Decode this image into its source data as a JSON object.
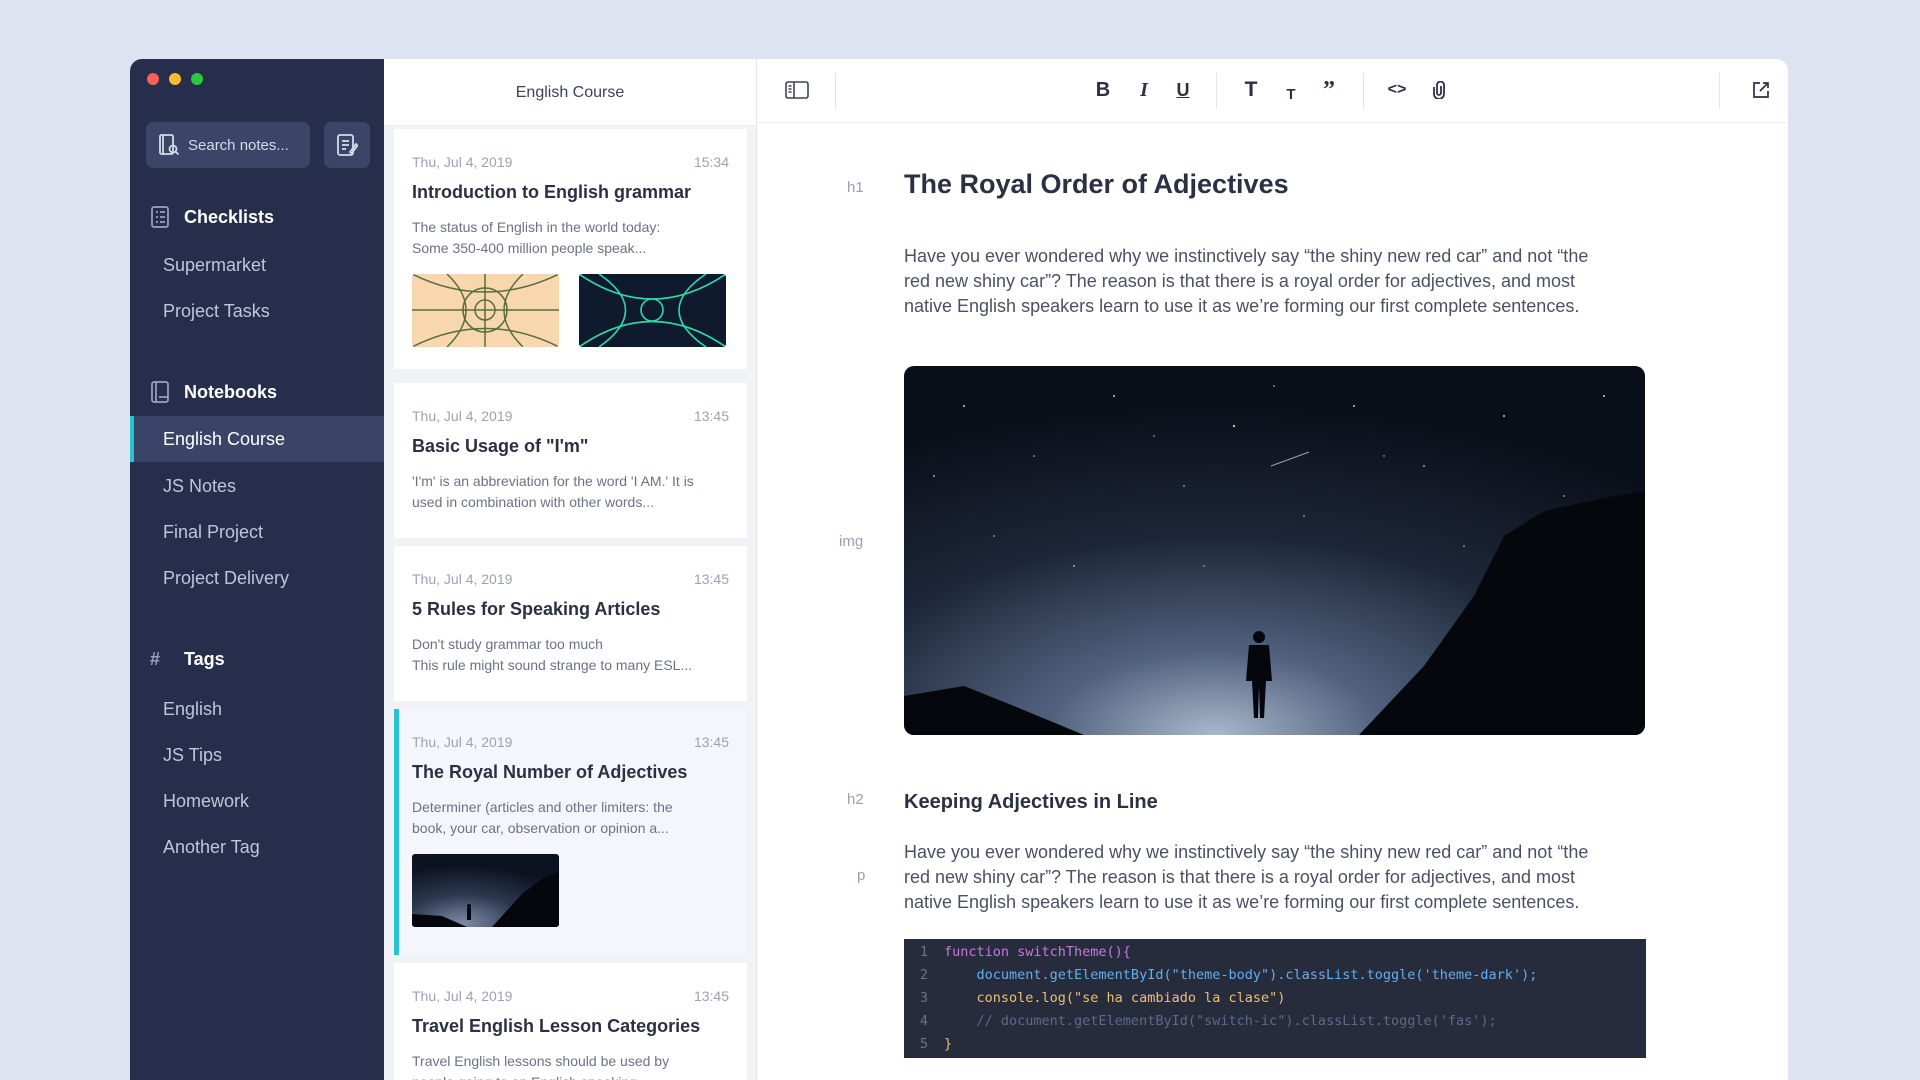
{
  "window": {
    "traffic_lights": [
      "#fe5f57",
      "#febc2e",
      "#28c840"
    ]
  },
  "sidebar": {
    "search_placeholder": "Search notes...",
    "checklists": {
      "title": "Checklists",
      "items": [
        "Supermarket",
        "Project Tasks"
      ]
    },
    "notebooks": {
      "title": "Notebooks",
      "items": [
        "English Course",
        "JS Notes",
        "Final Project",
        "Project Delivery"
      ],
      "active": "English Course"
    },
    "tags": {
      "title": "Tags",
      "items": [
        "English",
        "JS Tips",
        "Homework",
        "Another Tag"
      ]
    }
  },
  "notelist": {
    "title": "English Course",
    "notes": [
      {
        "date": "Thu, Jul 4, 2019",
        "time": "15:34",
        "title": "Introduction to English grammar",
        "snippet1": "The status of English in the world today:",
        "snippet2": "Some 350-400 million people speak..."
      },
      {
        "date": "Thu, Jul 4, 2019",
        "time": "13:45",
        "title": "Basic Usage of \"I'm\"",
        "snippet1": "'I'm' is an abbreviation for the word 'I AM.' It is",
        "snippet2": "used in combination with other words..."
      },
      {
        "date": "Thu, Jul 4, 2019",
        "time": "13:45",
        "title": "5 Rules for Speaking Articles",
        "snippet1": "Don't study grammar too much",
        "snippet2": "This rule might sound strange to many ESL..."
      },
      {
        "date": "Thu, Jul 4, 2019",
        "time": "13:45",
        "title": "The Royal Number of Adjectives",
        "snippet1": "Determiner (articles and other limiters: the",
        "snippet2": "book, your car, observation or opinion a..."
      },
      {
        "date": "Thu, Jul 4, 2019",
        "time": "13:45",
        "title": "Travel English Lesson Categories",
        "snippet1": "Travel English lessons should be used by",
        "snippet2": "people going to an English speaking..."
      }
    ]
  },
  "editor": {
    "gutter": {
      "h1": "h1",
      "img": "img",
      "h2": "h2",
      "p": "p"
    },
    "title": "The Royal Order of Adjectives",
    "intro": {
      "line1": "Have you ever wondered why we instinctively say “the shiny new red car” and not “the",
      "line2": "red new shiny car”? The reason is that there is a royal order for adjectives, and most",
      "line3": "native English speakers learn to use it as we’re forming our first complete sentences."
    },
    "subtitle": "Keeping Adjectives in Line",
    "body": {
      "line1": "Have you ever wondered why we instinctively say “the shiny new red car” and not “the",
      "line2": "red new shiny car”? The reason is that there is a royal order for adjectives, and most",
      "line3": "native English speakers learn to use it as we’re forming our first complete sentences."
    },
    "code": [
      {
        "n": "1",
        "text": "function switchTheme(){"
      },
      {
        "n": "2",
        "text": "    document.getElementById(\"theme-body\").classList.toggle('theme-dark');"
      },
      {
        "n": "3",
        "text": "    console.log(\"se ha cambiado la clase\")"
      },
      {
        "n": "4",
        "text": "    // document.getElementById(\"switch-ic\").classList.toggle('fas');"
      },
      {
        "n": "5",
        "text": "}"
      }
    ]
  },
  "toolbar": {
    "icons": [
      "sidebar-toggle-icon",
      "bold-icon",
      "italic-icon",
      "underline-icon",
      "heading-large-icon",
      "heading-small-icon",
      "quote-icon",
      "code-icon",
      "attachment-icon",
      "share-icon"
    ]
  },
  "colors": {
    "accent": "#27c4cf",
    "sidebar_bg": "#262e4b",
    "page_bg": "#dde3f0"
  }
}
